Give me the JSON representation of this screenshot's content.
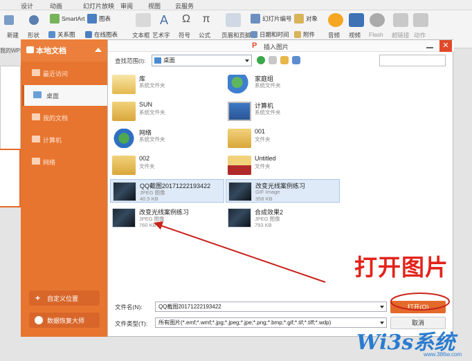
{
  "ribbon": {
    "tabs": [
      "设计",
      "动画",
      "幻灯片放映",
      "审阅",
      "视图",
      "云服务"
    ],
    "tools": {
      "new_slide": "新建",
      "shape": "形状",
      "smartart": "SmartArt",
      "chart": "图表",
      "relation": "关系图",
      "online_chart": "在线图表",
      "textbox": "文本框",
      "wordart": "艺术字",
      "symbol": "符号",
      "formula": "公式",
      "header_footer": "页眉和页脚",
      "date_time": "日期和时间",
      "slide_number": "幻灯片编号",
      "object": "对象",
      "attachment": "附件",
      "audio": "音频",
      "video": "视频",
      "flash": "Flash",
      "hyperlink": "超链接",
      "action": "动作"
    }
  },
  "background": {
    "wps_label": "我的WPS"
  },
  "dialog": {
    "left_panel": {
      "header": "本地文档",
      "items": [
        {
          "label": "最近访问",
          "active": false
        },
        {
          "label": "桌面",
          "active": true
        },
        {
          "label": "我的文档",
          "active": false
        },
        {
          "label": "计算机",
          "active": false
        },
        {
          "label": "网络",
          "active": false
        }
      ],
      "custom_location": "自定义位置",
      "data_recovery": "数据恢复大师"
    },
    "title": "插入图片",
    "look_in_label": "查找范围(I):",
    "look_in_value": "桌面",
    "files": [
      {
        "name": "库",
        "type": "系统文件夹",
        "size": "",
        "kind": "library",
        "selected": false
      },
      {
        "name": "家庭组",
        "type": "系统文件夹",
        "size": "",
        "kind": "homegroup",
        "selected": false
      },
      {
        "name": "SUN",
        "type": "系统文件夹",
        "size": "",
        "kind": "user",
        "selected": false
      },
      {
        "name": "计算机",
        "type": "系统文件夹",
        "size": "",
        "kind": "computer",
        "selected": false
      },
      {
        "name": "网络",
        "type": "系统文件夹",
        "size": "",
        "kind": "network",
        "selected": false
      },
      {
        "name": "001",
        "type": "文件夹",
        "size": "",
        "kind": "folder",
        "selected": false
      },
      {
        "name": "002",
        "type": "文件夹",
        "size": "",
        "kind": "folder",
        "selected": false
      },
      {
        "name": "Untitled",
        "type": "文件夹",
        "size": "",
        "kind": "folder-red",
        "selected": false
      },
      {
        "name": "QQ截图20171222193422",
        "type": "JPEG 图像",
        "size": "40.5 KB",
        "kind": "image",
        "selected": true
      },
      {
        "name": "改变光线案例练习",
        "type": "GIF Image",
        "size": "358 KB",
        "kind": "image",
        "selected": true
      },
      {
        "name": "改变光线案例练习",
        "type": "JPEG 图像",
        "size": "760 KB",
        "kind": "image",
        "selected": false
      },
      {
        "name": "合成效果2",
        "type": "JPEG 图像",
        "size": "793 KB",
        "kind": "image",
        "selected": false
      }
    ],
    "filename_label": "文件名(N):",
    "filename_value": "QQ截图20171222193422",
    "filetype_label": "文件类型(T):",
    "filetype_value": "所有图片(*.emf;*.wmf;*.jpg;*.jpeg;*.jpe;*.png;*.bmp;*.gif;*.tif;*.tiff;*.wdp)",
    "open_button": "打开(O)",
    "cancel_button": "取消"
  },
  "annotation": {
    "text": "打开图片",
    "color": "#e2231a"
  },
  "watermark": {
    "text": "Wi3s系统",
    "url": "www.386w.com"
  },
  "colors": {
    "accent": "#e8752f",
    "close": "#e04a2a",
    "selection": "#dfeaf8"
  }
}
